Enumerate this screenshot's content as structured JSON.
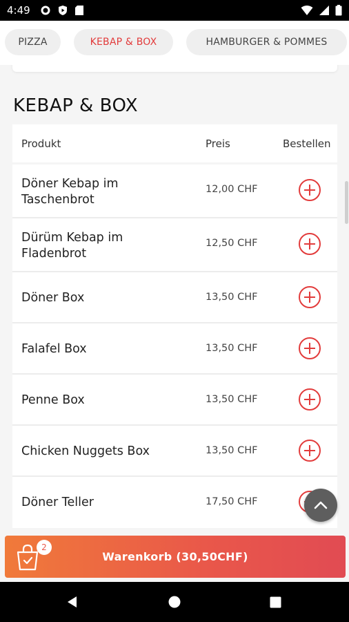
{
  "statusbar": {
    "time": "4:49"
  },
  "categories": [
    {
      "label": "PIZZA",
      "active": false
    },
    {
      "label": "KEBAP & BOX",
      "active": true
    },
    {
      "label": "HAMBURGER & POMMES",
      "active": false
    }
  ],
  "section": {
    "title": "KEBAP & BOX"
  },
  "table": {
    "headers": {
      "product": "Produkt",
      "price": "Preis",
      "order": "Bestellen"
    },
    "rows": [
      {
        "name": "Döner Kebap im Taschenbrot",
        "price": "12,00 CHF"
      },
      {
        "name": "Dürüm Kebap im Fladenbrot",
        "price": "12,50 CHF"
      },
      {
        "name": "Döner Box",
        "price": "13,50 CHF"
      },
      {
        "name": "Falafel Box",
        "price": "13,50 CHF"
      },
      {
        "name": "Penne Box",
        "price": "13,50 CHF"
      },
      {
        "name": "Chicken Nuggets Box",
        "price": "13,50 CHF"
      },
      {
        "name": "Döner Teller",
        "price": "17,50 CHF"
      }
    ]
  },
  "cart": {
    "count": "2",
    "label": "Warenkorb (30,50CHF)"
  },
  "colors": {
    "accent": "#e23b3b",
    "cart_start": "#f07a3a",
    "cart_end": "#e14b53"
  },
  "icons": {
    "add": "plus-circle-icon",
    "scroll_top": "chevron-up-icon",
    "cart": "shopping-bag-icon"
  }
}
